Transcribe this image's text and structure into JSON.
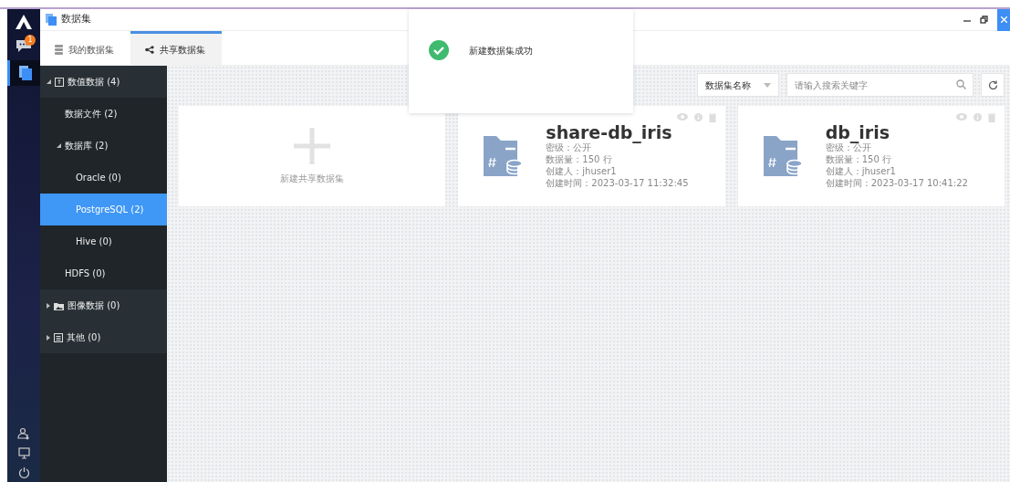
{
  "window": {
    "title": "数据集"
  },
  "rail": {
    "badge": "1"
  },
  "tabs": [
    {
      "label": "我的数据集",
      "kind": "database",
      "selected": false
    },
    {
      "label": "共享数据集",
      "kind": "share",
      "selected": true
    }
  ],
  "tree": [
    {
      "label": "数值数据 (4)",
      "kind": "numeric",
      "expanded": true,
      "selected": false,
      "children": [
        {
          "label": "数据文件 (2)",
          "selected": false
        },
        {
          "label": "数据库 (2)",
          "expanded": true,
          "selected": false,
          "children": [
            {
              "label": "Oracle (0)",
              "selected": false
            },
            {
              "label": "PostgreSQL (2)",
              "selected": true
            },
            {
              "label": "Hive (0)",
              "selected": false
            }
          ]
        },
        {
          "label": "HDFS (0)",
          "selected": false
        }
      ]
    },
    {
      "label": "图像数据 (0)",
      "kind": "image",
      "expanded": false,
      "selected": false
    },
    {
      "label": "其他 (0)",
      "kind": "other",
      "expanded": false,
      "selected": false
    }
  ],
  "toolbar": {
    "filter": "数据集名称",
    "search_placeholder": "请输入搜索关键字"
  },
  "new_card": {
    "label": "新建共享数据集"
  },
  "datasets": [
    {
      "name": "share-db_iris",
      "fields": [
        "密级：公开",
        "数据量：150 行",
        "创建人：jhuser1",
        "创建时间：2023-03-17 11:32:45"
      ]
    },
    {
      "name": "db_iris",
      "fields": [
        "密级：公开",
        "数据量：150 行",
        "创建人：jhuser1",
        "创建时间：2023-03-17 10:41:22"
      ]
    }
  ],
  "toast": {
    "message": "新建数据集成功"
  }
}
